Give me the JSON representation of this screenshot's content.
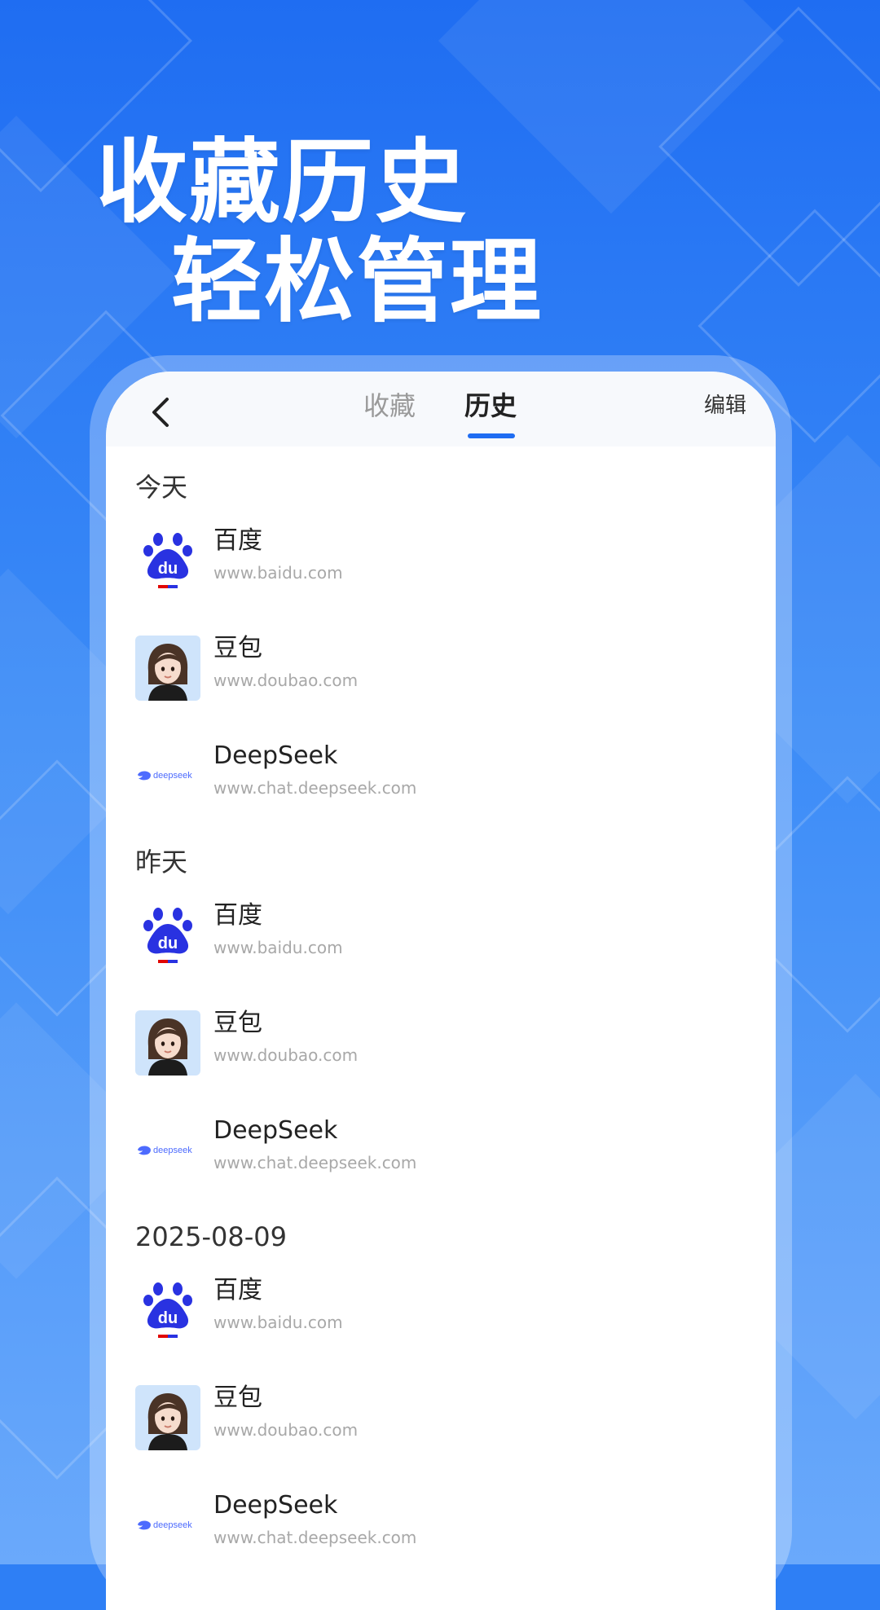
{
  "headline": {
    "line1": "收藏历史",
    "line2": "轻松管理"
  },
  "header": {
    "tabs": [
      {
        "label": "收藏",
        "active": false
      },
      {
        "label": "历史",
        "active": true
      }
    ],
    "edit_label": "编辑"
  },
  "sections": [
    {
      "title": "今天",
      "items": [
        {
          "name": "百度",
          "url": "www.baidu.com",
          "icon": "baidu-logo"
        },
        {
          "name": "豆包",
          "url": "www.doubao.com",
          "icon": "doubao-avatar"
        },
        {
          "name": "DeepSeek",
          "url": "www.chat.deepseek.com",
          "icon": "deepseek-logo"
        }
      ]
    },
    {
      "title": "昨天",
      "items": [
        {
          "name": "百度",
          "url": "www.baidu.com",
          "icon": "baidu-logo"
        },
        {
          "name": "豆包",
          "url": "www.doubao.com",
          "icon": "doubao-avatar"
        },
        {
          "name": "DeepSeek",
          "url": "www.chat.deepseek.com",
          "icon": "deepseek-logo"
        }
      ]
    },
    {
      "title": "2025-08-09",
      "items": [
        {
          "name": "百度",
          "url": "www.baidu.com",
          "icon": "baidu-logo"
        },
        {
          "name": "豆包",
          "url": "www.doubao.com",
          "icon": "doubao-avatar"
        },
        {
          "name": "DeepSeek",
          "url": "www.chat.deepseek.com",
          "icon": "deepseek-logo"
        }
      ]
    }
  ],
  "logo_text": {
    "baidu": "du",
    "deepseek": "deepseek"
  },
  "colors": {
    "accent": "#1f6df2",
    "baidu_blue": "#2932e1",
    "baidu_red": "#e10602",
    "deepseek_blue": "#4d6bfe"
  }
}
